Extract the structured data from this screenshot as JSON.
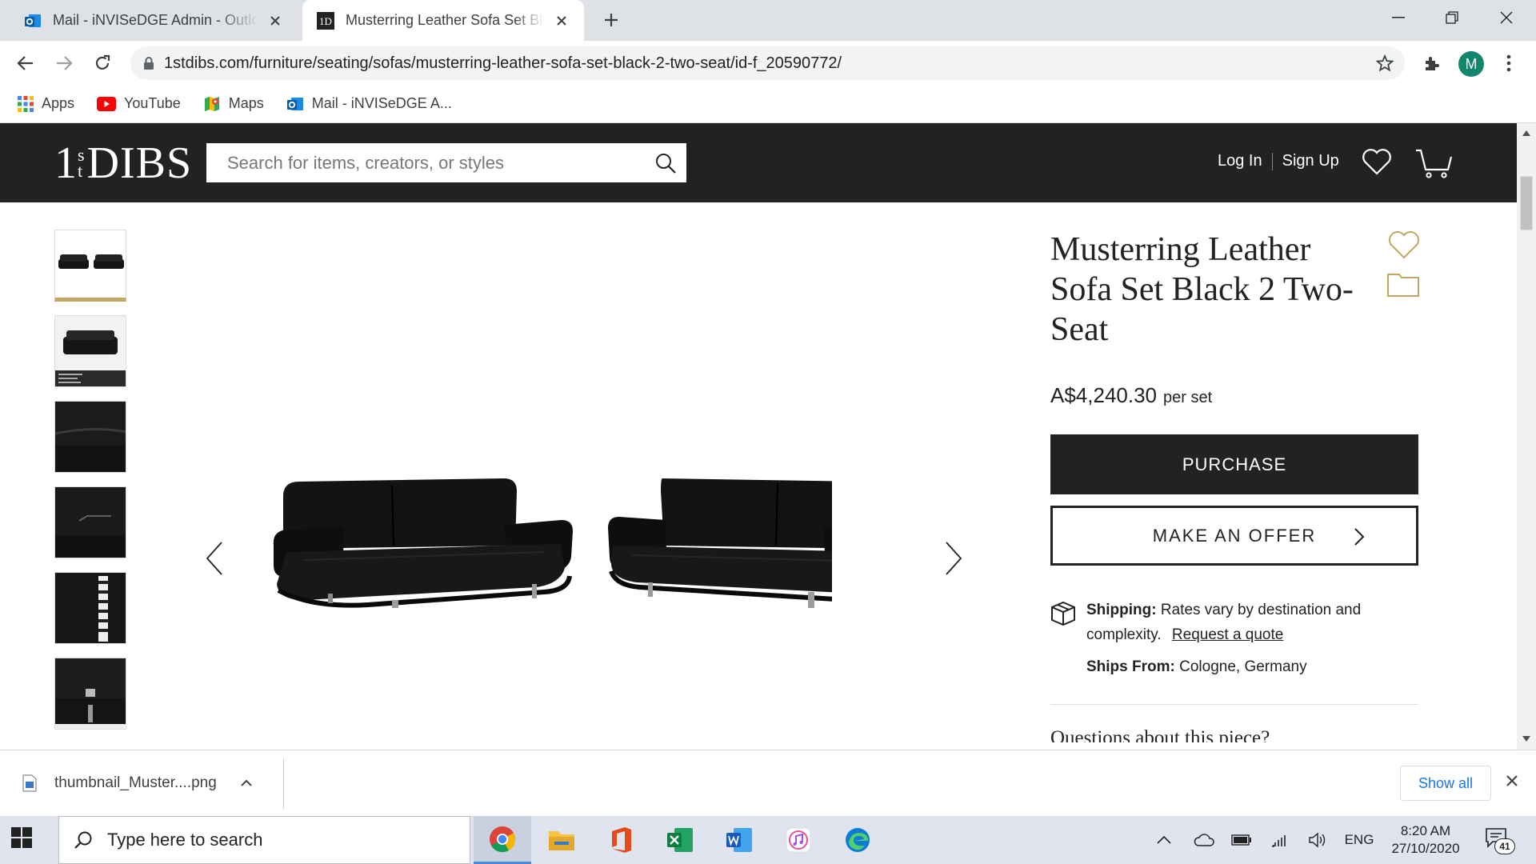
{
  "browser": {
    "tabs": [
      {
        "title": "Mail - iNVISeDGE Admin - Outlook",
        "icon": "outlook-icon",
        "active": false
      },
      {
        "title": "Musterring Leather Sofa Set Black",
        "icon": "1stdibs-favicon",
        "active": true
      }
    ],
    "url": "1stdibs.com/furniture/seating/sofas/musterring-leather-sofa-set-black-2-two-seat/id-f_20590772/",
    "profile_initial": "M",
    "bookmarks": [
      {
        "label": "Apps",
        "icon": "apps-grid-icon"
      },
      {
        "label": "YouTube",
        "icon": "youtube-icon"
      },
      {
        "label": "Maps",
        "icon": "maps-icon"
      },
      {
        "label": "Mail - iNVISeDGE A...",
        "icon": "outlook-icon"
      }
    ]
  },
  "site": {
    "logo": {
      "sup_top": "s",
      "sup_bottom": "t",
      "num": "1",
      "word": "DIBS"
    },
    "search_placeholder": "Search for items, creators, or styles",
    "login": "Log In",
    "signup": "Sign Up"
  },
  "product": {
    "title": "Musterring Leather Sofa Set Black 2 Two-Seat",
    "price": "A$4,240.30",
    "price_unit": "per set",
    "purchase_label": "PURCHASE",
    "offer_label": "MAKE AN OFFER",
    "shipping_label": "Shipping:",
    "shipping_text": "Rates vary by destination and complexity.",
    "shipping_link": "Request a quote",
    "ships_from_label": "Ships From:",
    "ships_from_value": "Cologne, Germany",
    "questions_heading": "Questions about this piece?",
    "accent_color": "#c2a661"
  },
  "download": {
    "filename": "thumbnail_Muster....png",
    "show_all": "Show all"
  },
  "taskbar": {
    "search_placeholder": "Type here to search",
    "language": "ENG",
    "time": "8:20 AM",
    "date": "27/10/2020",
    "notifications": "41"
  }
}
